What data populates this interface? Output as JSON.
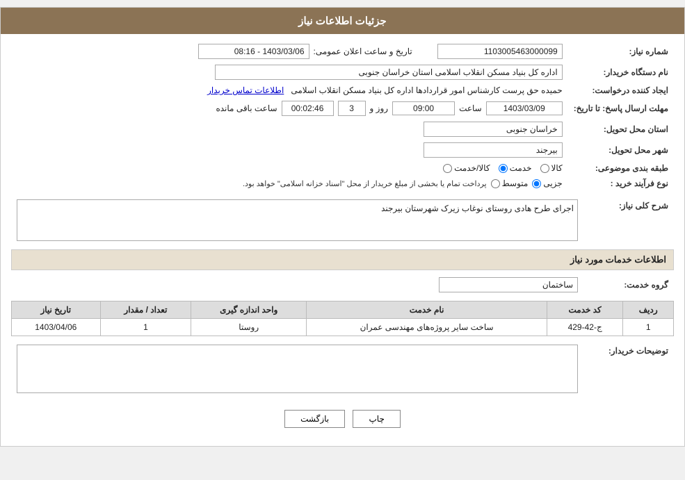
{
  "header": {
    "title": "جزئیات اطلاعات نیاز"
  },
  "fields": {
    "shomareNiaz_label": "شماره نیاز:",
    "shomareNiaz_value": "1103005463000099",
    "namDastgah_label": "نام دستگاه خریدار:",
    "namDastgah_value": "اداره کل بنیاد مسکن انقلاب اسلامی استان خراسان جنوبی",
    "tarikh_label": "تاریخ و ساعت اعلان عمومی:",
    "tarikh_value": "1403/03/06 - 08:16",
    "ijadKonande_label": "ایجاد کننده درخواست:",
    "ijadKonande_value": "حمیده حق پرست کارشناس امور قراردادها اداره کل بنیاد مسکن انقلاب اسلامی",
    "ettelaatTamas_link": "اطلاعات تماس خریدار",
    "mohlat_label": "مهلت ارسال پاسخ: تا تاریخ:",
    "mohlat_date": "1403/03/09",
    "mohlat_saat_label": "ساعت",
    "mohlat_saat": "09:00",
    "mohlat_roz_label": "روز و",
    "mohlat_roz": "3",
    "mohlat_baqi_label": "ساعت باقی مانده",
    "mohlat_baqi": "00:02:46",
    "ostan_label": "استان محل تحویل:",
    "ostan_value": "خراسان جنوبی",
    "shahr_label": "شهر محل تحویل:",
    "shahr_value": "بیرجند",
    "tabagheBandi_label": "طبقه بندی موضوعی:",
    "kala_label": "کالا",
    "khedmat_label": "خدمت",
    "kalaKhedmat_label": "کالا/خدمت",
    "kala_selected": false,
    "khedmat_selected": true,
    "kalaKhedmat_selected": false,
    "noeFarayand_label": "نوع فرآیند خرید :",
    "jozii_label": "جزیی",
    "motavaset_label": "متوسط",
    "noeFarayand_note": "پرداخت تمام یا بخشی از مبلغ خریدار از محل \"اسناد خزانه اسلامی\" خواهد بود.",
    "sharh_label": "شرح کلی نیاز:",
    "sharh_value": "اجرای طرح هادی روستای نوغاب زیرک شهرستان بیرجند",
    "khadamat_label": "اطلاعات خدمات مورد نیاز",
    "groheKhedmat_label": "گروه خدمت:",
    "groheKhedmat_value": "ساختمان",
    "table": {
      "cols": [
        "ردیف",
        "کد خدمت",
        "نام خدمت",
        "واحد اندازه گیری",
        "تعداد / مقدار",
        "تاریخ نیاز"
      ],
      "rows": [
        {
          "radif": "1",
          "kodKhedmat": "ج-42-429",
          "namKhedmat": "ساخت سایر پروژه‌های مهندسی عمران",
          "vahed": "روستا",
          "tedad": "1",
          "tarikh": "1403/04/06"
        }
      ]
    },
    "tozihat_label": "توضیحات خریدار:",
    "tozihat_value": ""
  },
  "buttons": {
    "print": "چاپ",
    "back": "بازگشت"
  }
}
